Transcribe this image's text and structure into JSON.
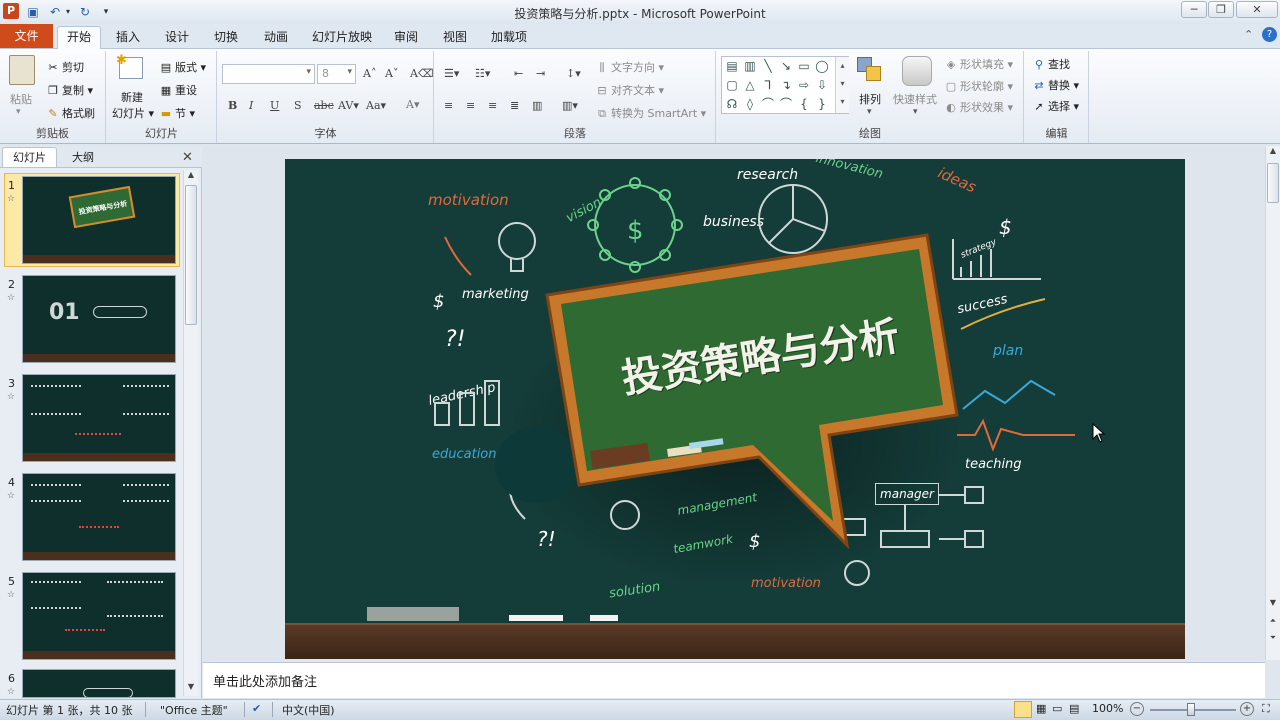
{
  "app": {
    "title": "投资策略与分析.pptx - Microsoft PowerPoint"
  },
  "tabs": {
    "file": "文件",
    "items": [
      "开始",
      "插入",
      "设计",
      "切换",
      "动画",
      "幻灯片放映",
      "审阅",
      "视图",
      "加载项"
    ]
  },
  "ribbon": {
    "clipboard": {
      "label": "剪贴板",
      "paste": "粘贴",
      "cut": "剪切",
      "copy": "复制",
      "format_painter": "格式刷"
    },
    "slides": {
      "label": "幻灯片",
      "new_slide_1": "新建",
      "new_slide_2": "幻灯片",
      "layout": "版式",
      "reset": "重设",
      "section": "节"
    },
    "font": {
      "label": "字体",
      "size": "8"
    },
    "paragraph": {
      "label": "段落",
      "text_direction": "文字方向",
      "align_text": "对齐文本",
      "convert_smartart": "转换为 SmartArt"
    },
    "drawing": {
      "label": "绘图",
      "arrange": "排列",
      "quick_styles": "快速样式",
      "shape_fill": "形状填充",
      "shape_outline": "形状轮廓",
      "shape_effects": "形状效果"
    },
    "editing": {
      "label": "编辑",
      "find": "查找",
      "replace": "替换",
      "select": "选择"
    }
  },
  "panel": {
    "tab_slides": "幻灯片",
    "tab_outline": "大纲",
    "close": "✕",
    "thumbs": [
      {
        "num": "1",
        "title": "投资策略与分析"
      },
      {
        "num": "2",
        "big": "01"
      },
      {
        "num": "3"
      },
      {
        "num": "4"
      },
      {
        "num": "5"
      },
      {
        "num": "6"
      }
    ]
  },
  "slide": {
    "title": "投资策略与分析",
    "doodles": [
      "motivation",
      "research",
      "innovation",
      "ideas",
      "business",
      "vision",
      "marketing",
      "strategy",
      "success",
      "plan",
      "leadership",
      "education",
      "teaching",
      "manager",
      "management",
      "teamwork",
      "solution",
      "motivation",
      "?!",
      "?!",
      "$",
      "$",
      "$"
    ]
  },
  "notes": {
    "placeholder": "单击此处添加备注"
  },
  "status": {
    "slide_info": "幻灯片 第 1 张，共 10 张",
    "theme": "\"Office 主题\"",
    "language": "中文(中国)",
    "zoom": "100%"
  }
}
